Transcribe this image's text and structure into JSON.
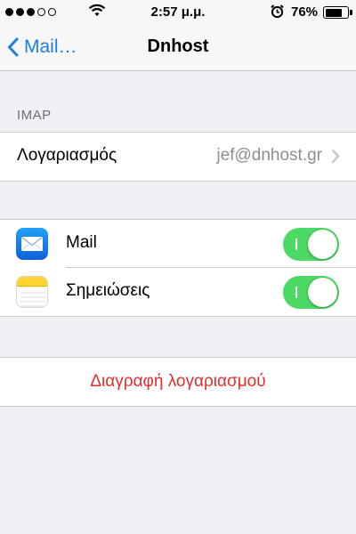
{
  "status_bar": {
    "time": "2:57 μ.μ.",
    "battery_percent": "76%",
    "battery_level": 0.76,
    "signal_bars": 3,
    "signal_total": 5
  },
  "nav": {
    "back_label": "Mail…",
    "title": "Dnhost"
  },
  "imap_section": {
    "header": "IMAP",
    "account_label": "Λογαριασμός",
    "account_value": "jef@dnhost.gr"
  },
  "sync_items": [
    {
      "label": "Mail",
      "icon": "mail-icon",
      "enabled": true
    },
    {
      "label": "Σημειώσεις",
      "icon": "notes-icon",
      "enabled": true
    }
  ],
  "delete_account_label": "Διαγραφή λογαριασμού",
  "colors": {
    "accent": "#1a7fe3",
    "toggle_on": "#4cd964",
    "destructive": "#e0302d",
    "background": "#efeff4"
  }
}
